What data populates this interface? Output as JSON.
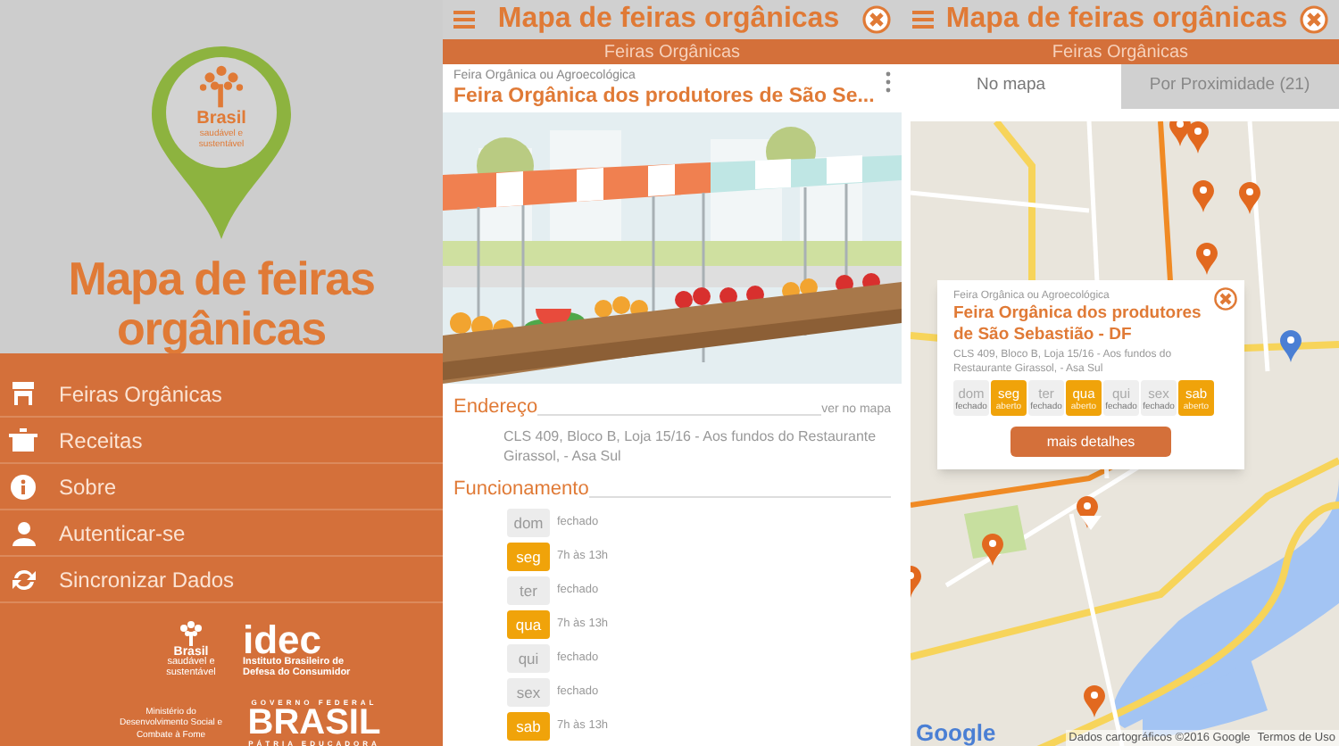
{
  "menu_screen": {
    "logo": {
      "brand": "Brasil",
      "tagline": "saudável e sustentável"
    },
    "app_title": [
      "Mapa de feiras",
      "orgânicas"
    ],
    "items": [
      {
        "label": "Feiras Orgânicas"
      },
      {
        "label": "Receitas"
      },
      {
        "label": "Sobre"
      },
      {
        "label": "Autenticar-se"
      },
      {
        "label": "Sincronizar Dados"
      }
    ],
    "partners": {
      "brand": "Brasil",
      "brand_tagline": "saudável e sustentável",
      "idec": "idec",
      "idec_subtitle": "Instituto Brasileiro de Defesa do Consumidor",
      "ministry": "Ministério do Desenvolvimento Social e Combate à Fome",
      "gov_top": "GOVERNO FEDERAL",
      "gov_name": "BRASIL",
      "gov_motto": "PÁTRIA EDUCADORA"
    }
  },
  "detail_screen": {
    "header_title": "Mapa de feiras orgânicas",
    "section_bar": "Feiras Orgânicas",
    "category": "Feira Orgânica ou Agroecológica",
    "title": "Feira Orgânica dos produtores de São Se...",
    "address_heading": "Endereço",
    "map_link": "ver no mapa",
    "address": "CLS 409, Bloco B, Loja 15/16 - Aos fundos do Restaurante Girassol, - Asa Sul",
    "hours_heading": "Funcionamento",
    "days": [
      {
        "day": "dom",
        "hours": "fechado",
        "open": false
      },
      {
        "day": "seg",
        "hours": "7h às 13h",
        "open": true
      },
      {
        "day": "ter",
        "hours": "fechado",
        "open": false
      },
      {
        "day": "qua",
        "hours": "7h às 13h",
        "open": true
      },
      {
        "day": "qui",
        "hours": "fechado",
        "open": false
      },
      {
        "day": "sex",
        "hours": "fechado",
        "open": false
      },
      {
        "day": "sab",
        "hours": "7h às 13h",
        "open": true
      }
    ]
  },
  "map_screen": {
    "header_title": "Mapa de feiras orgânicas",
    "section_bar": "Feiras Orgânicas",
    "tabs": [
      {
        "label": "No mapa",
        "selected": true
      },
      {
        "label": "Por Proximidade (21)",
        "selected": false
      }
    ],
    "popup": {
      "category": "Feira Orgânica ou Agroecológica",
      "title": "Feira Orgânica dos produtores de São Sebastião - DF",
      "address": "CLS 409, Bloco B, Loja 15/16 - Aos fundos do Restaurante Girassol, - Asa Sul",
      "days": [
        {
          "day": "dom",
          "status": "fechado",
          "open": false
        },
        {
          "day": "seg",
          "status": "aberto",
          "open": true
        },
        {
          "day": "ter",
          "status": "fechado",
          "open": false
        },
        {
          "day": "qua",
          "status": "aberto",
          "open": true
        },
        {
          "day": "qui",
          "status": "fechado",
          "open": false
        },
        {
          "day": "sex",
          "status": "fechado",
          "open": false
        },
        {
          "day": "sab",
          "status": "aberto",
          "open": true
        }
      ],
      "button": "mais detalhes"
    },
    "provider_logo": "Google",
    "attribution": "Dados cartográficos ©2016 Google",
    "terms": "Termos de Uso"
  }
}
